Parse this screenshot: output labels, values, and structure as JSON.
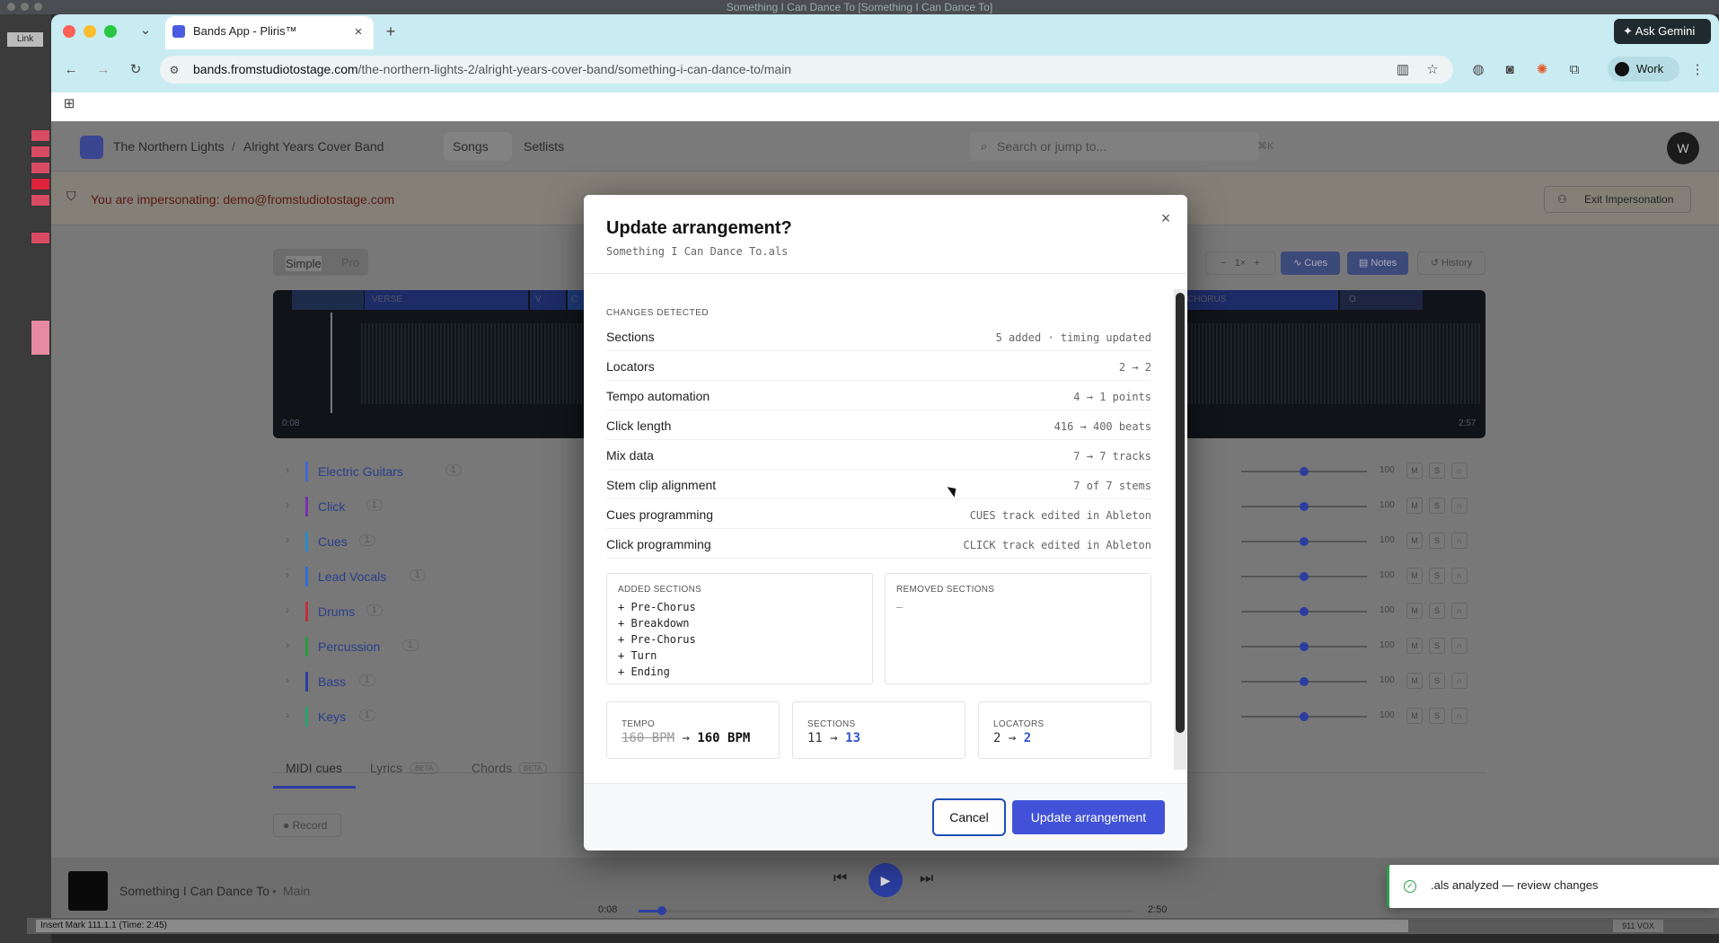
{
  "os": {
    "window_title": "Something I Can Dance To  [Something I Can Dance To]"
  },
  "ableton": {
    "link_label": "Link",
    "status_text": "Insert Mark 111.1.1 (Time: 2:45)",
    "vox_label": "911 VOX"
  },
  "browser": {
    "tab_title": "Bands App - Pliris™",
    "url_host": "bands.fromstudiotostage.com",
    "url_path": "/the-northern-lights-2/alright-years-cover-band/something-i-can-dance-to/main",
    "ask_gemini": "Ask Gemini",
    "profile": "Work"
  },
  "app": {
    "breadcrumb_org": "The Northern Lights",
    "breadcrumb_band": "Alright Years Cover Band",
    "nav": [
      "Songs",
      "Setlists"
    ],
    "search_placeholder": "Search or jump to...",
    "search_kbd": "⌘K",
    "avatar": "W",
    "impersonation_text": "You are impersonating: demo@fromstudiotostage.com",
    "exit_impersonation": "Exit Impersonation",
    "mode_tabs": [
      "Simple",
      "Pro"
    ],
    "toolbar": {
      "zoom": "1×",
      "cues": "Cues",
      "notes": "Notes",
      "history": "History"
    },
    "wave_sections": [
      "VERSE",
      "V",
      "C",
      "CHORUS",
      "O"
    ],
    "wave_time_start": "0:08",
    "wave_time_end": "2:57",
    "tracks": [
      {
        "name": "Electric Guitars",
        "count": "1",
        "color": "#3f6bd8",
        "vol": "100"
      },
      {
        "name": "Click",
        "count": "1",
        "color": "#7a2fb0",
        "vol": "100"
      },
      {
        "name": "Cues",
        "count": "1",
        "color": "#2a8bc7",
        "vol": "100"
      },
      {
        "name": "Lead Vocals",
        "count": "1",
        "color": "#2a6fd8",
        "vol": "100"
      },
      {
        "name": "Drums",
        "count": "1",
        "color": "#c0303a",
        "vol": "100"
      },
      {
        "name": "Percussion",
        "count": "1",
        "color": "#2b9a3e",
        "vol": "100"
      },
      {
        "name": "Bass",
        "count": "1",
        "color": "#2a3fa0",
        "vol": "100"
      },
      {
        "name": "Keys",
        "count": "1",
        "color": "#2ba36e",
        "vol": "100"
      }
    ],
    "bottom_tabs": [
      {
        "label": "MIDI cues",
        "badge": ""
      },
      {
        "label": "Lyrics",
        "badge": "BETA"
      },
      {
        "label": "Chords",
        "badge": "BETA"
      }
    ],
    "record_label": "Record",
    "player": {
      "song": "Something I Can Dance To",
      "version": "Main",
      "time_current": "0:08",
      "time_total": "2:50"
    }
  },
  "modal": {
    "title": "Update arrangement?",
    "subtitle": "Something I Can Dance To.als",
    "changes_label": "CHANGES DETECTED",
    "changes": [
      {
        "key": "Sections",
        "value": "5 added · timing updated"
      },
      {
        "key": "Locators",
        "value": "2 → 2"
      },
      {
        "key": "Tempo automation",
        "value": "4 → 1 points"
      },
      {
        "key": "Click length",
        "value": "416 → 400 beats"
      },
      {
        "key": "Mix data",
        "value": "7 → 7 tracks"
      },
      {
        "key": "Stem clip alignment",
        "value": "7 of 7 stems"
      },
      {
        "key": "Cues programming",
        "value": "CUES track edited in Ableton"
      },
      {
        "key": "Click programming",
        "value": "CLICK track edited in Ableton"
      }
    ],
    "added_label": "ADDED SECTIONS",
    "added": [
      "+ Pre-Chorus",
      "+ Breakdown",
      "+ Pre-Chorus",
      "+ Turn",
      "+ Ending"
    ],
    "removed_label": "REMOVED SECTIONS",
    "removed": "—",
    "stats": [
      {
        "label": "TEMPO",
        "from": "160 BPM",
        "arrow": "→",
        "to": "160 BPM"
      },
      {
        "label": "SECTIONS",
        "from": "11",
        "arrow": "→",
        "to": "13"
      },
      {
        "label": "LOCATORS",
        "from": "2",
        "arrow": "→",
        "to": "2"
      }
    ],
    "cancel": "Cancel",
    "confirm": "Update arrangement"
  },
  "toast": {
    "text": ".als analyzed — review changes"
  }
}
